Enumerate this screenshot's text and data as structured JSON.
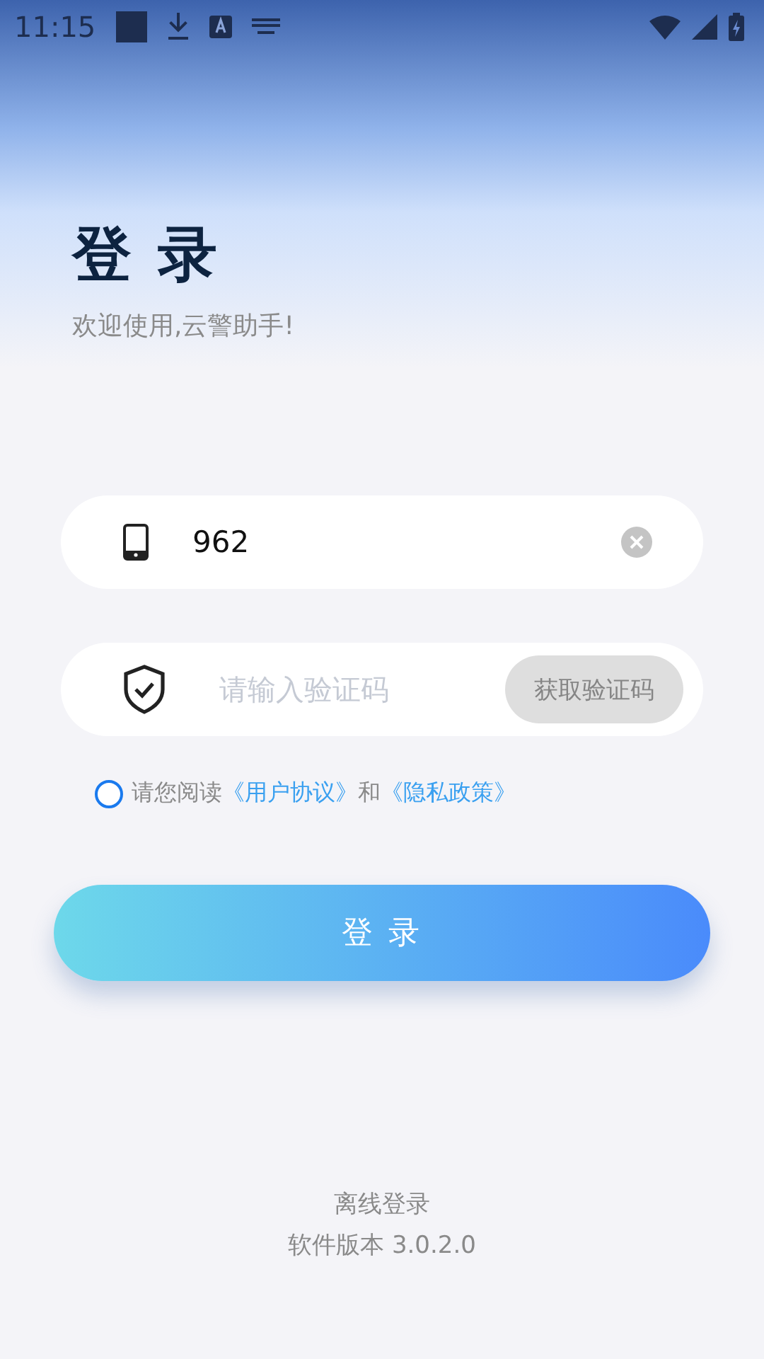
{
  "status_bar": {
    "time": "11:15"
  },
  "title": "登 录",
  "subtitle": "欢迎使用,云警助手!",
  "phone_field": {
    "value": "962"
  },
  "code_field": {
    "placeholder": "请输入验证码",
    "button": "获取验证码",
    "button_disabled": true
  },
  "agreement": {
    "checked": false,
    "parts": [
      {
        "kind": "text",
        "text": "请您阅读"
      },
      {
        "kind": "link",
        "text": "《用户协议》"
      },
      {
        "kind": "text",
        "text": "和"
      },
      {
        "kind": "link",
        "text": "《隐私政策》"
      }
    ]
  },
  "login_button": "登 录",
  "footer": {
    "offline_login": "离线登录",
    "version": "软件版本 3.0.2.0"
  }
}
